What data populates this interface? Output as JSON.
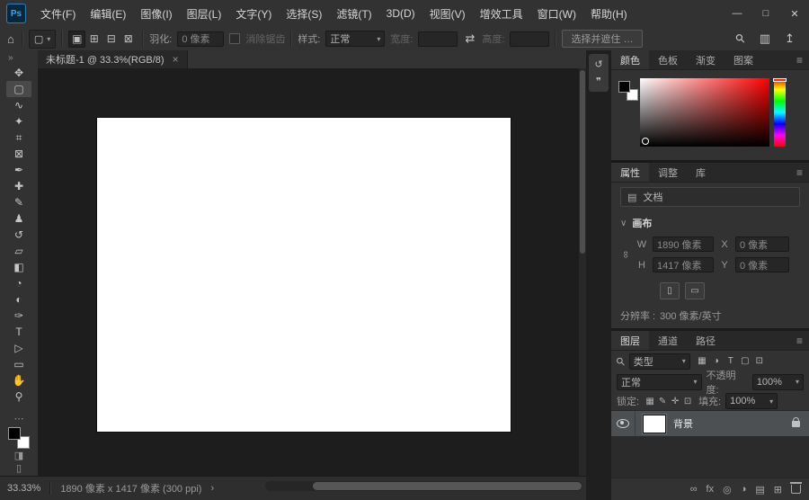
{
  "titlebar": {
    "logo": "Ps",
    "menus": [
      "文件(F)",
      "编辑(E)",
      "图像(I)",
      "图层(L)",
      "文字(Y)",
      "选择(S)",
      "滤镜(T)",
      "3D(D)",
      "视图(V)",
      "增效工具",
      "窗口(W)",
      "帮助(H)"
    ],
    "minimize": "—",
    "maximize": "□",
    "close": "✕"
  },
  "options_bar": {
    "home_icon": "⌂",
    "tool_preset_icon": "▢",
    "caret": "▾",
    "modes": [
      {
        "name": "new-selection-mode-button",
        "glyph": "▣",
        "active": true
      },
      {
        "name": "add-to-selection-mode-button",
        "glyph": "⊞"
      },
      {
        "name": "subtract-from-selection-mode-button",
        "glyph": "⊟"
      },
      {
        "name": "intersect-selection-mode-button",
        "glyph": "⊠"
      }
    ],
    "feather_label": "羽化:",
    "feather_value": "0 像素",
    "antialias_label": "消除锯齿",
    "style_label": "样式:",
    "style_value": "正常",
    "width_label": "宽度:",
    "width_value": "",
    "swap_icon": "⇄",
    "height_label": "高度:",
    "height_value": "",
    "select_and_mask_label": "选择并遮住 …",
    "search_icon": "⚲",
    "workspace_icon": "▥",
    "share_icon": "↥"
  },
  "document_tab": {
    "title": "未标题-1 @ 33.3%(RGB/8)",
    "close_icon": "×"
  },
  "toolbar": {
    "collapse_icon": "»",
    "tools": [
      {
        "name": "move-tool",
        "glyph": "✥"
      },
      {
        "name": "rectangular-marquee-tool",
        "glyph": "▢",
        "active": true
      },
      {
        "name": "lasso-tool",
        "glyph": "∿"
      },
      {
        "name": "quick-selection-tool",
        "glyph": "✦"
      },
      {
        "name": "crop-tool",
        "glyph": "⌗"
      },
      {
        "name": "frame-tool",
        "glyph": "⊠"
      },
      {
        "name": "eyedropper-tool",
        "glyph": "✒"
      },
      {
        "name": "spot-healing-brush-tool",
        "glyph": "✚"
      },
      {
        "name": "brush-tool",
        "glyph": "✎"
      },
      {
        "name": "clone-stamp-tool",
        "glyph": "♟"
      },
      {
        "name": "history-brush-tool",
        "glyph": "↺"
      },
      {
        "name": "eraser-tool",
        "glyph": "▱"
      },
      {
        "name": "gradient-tool",
        "glyph": "◧"
      },
      {
        "name": "blur-tool",
        "glyph": "◔"
      },
      {
        "name": "dodge-tool",
        "glyph": "◐"
      },
      {
        "name": "pen-tool",
        "glyph": "✑"
      },
      {
        "name": "type-tool",
        "glyph": "T"
      },
      {
        "name": "path-selection-tool",
        "glyph": "▷"
      },
      {
        "name": "rectangle-tool",
        "glyph": "▭"
      },
      {
        "name": "hand-tool",
        "glyph": "✋"
      },
      {
        "name": "zoom-tool",
        "glyph": "⚲"
      }
    ],
    "more_icon": "⋯",
    "quick_mask_icon": "◨",
    "screen_mode_icon": "▯"
  },
  "dock": {
    "buttons": [
      {
        "name": "history-panel-button",
        "glyph": "↺"
      },
      {
        "name": "comments-panel-button",
        "glyph": "❞"
      }
    ]
  },
  "color_panel": {
    "tabs": [
      {
        "name": "tab-color",
        "label": "颜色",
        "active": true
      },
      {
        "name": "tab-swatches",
        "label": "色板"
      },
      {
        "name": "tab-gradients",
        "label": "渐变"
      },
      {
        "name": "tab-patterns",
        "label": "图案"
      }
    ],
    "menu_icon": "≡"
  },
  "properties_panel": {
    "tabs": [
      {
        "name": "tab-properties",
        "label": "属性",
        "active": true
      },
      {
        "name": "tab-adjustments",
        "label": "调整"
      },
      {
        "name": "tab-libraries",
        "label": "库"
      }
    ],
    "menu_icon": "≡",
    "document_icon": "▤",
    "document_label": "文档",
    "canvas_caret": "∨",
    "canvas_label": "画布",
    "link_icon": "∞",
    "w_label": "W",
    "w_value": "1890 像素",
    "x_label": "X",
    "x_value": "0 像素",
    "h_label": "H",
    "h_value": "1417 像素",
    "y_label": "Y",
    "y_value": "0 像素",
    "portrait_icon": "▯",
    "landscape_icon": "▭",
    "resolution_label": "分辨率 :",
    "resolution_value": "300 像素/英寸"
  },
  "layers_panel": {
    "tabs": [
      {
        "name": "tab-layers",
        "label": "图层",
        "active": true
      },
      {
        "name": "tab-channels",
        "label": "通道"
      },
      {
        "name": "tab-paths",
        "label": "路径"
      }
    ],
    "menu_icon": "≡",
    "search_icon": "⚲",
    "filter_label": "类型",
    "caret": "▾",
    "filter_icons": [
      {
        "name": "filter-pixel-layers-icon",
        "glyph": "▦"
      },
      {
        "name": "filter-adjustment-layers-icon",
        "glyph": "◑"
      },
      {
        "name": "filter-type-layers-icon",
        "glyph": "T"
      },
      {
        "name": "filter-shape-layers-icon",
        "glyph": "▢"
      },
      {
        "name": "filter-smart-objects-icon",
        "glyph": "⊡"
      }
    ],
    "blend_mode": "正常",
    "opacity_label": "不透明度:",
    "opacity_value": "100%",
    "lock_label": "锁定:",
    "lock_icons": [
      {
        "name": "lock-transparent-pixels-icon",
        "glyph": "▦"
      },
      {
        "name": "lock-image-pixels-icon",
        "glyph": "✎"
      },
      {
        "name": "lock-position-icon",
        "glyph": "✛"
      },
      {
        "name": "lock-artboard-icon",
        "glyph": "⊡"
      }
    ],
    "fill_label": "填充:",
    "fill_value": "100%",
    "layer_name": "背景",
    "bottom_icons": [
      {
        "name": "link-layers-icon",
        "glyph": "∞"
      },
      {
        "name": "layer-effects-icon",
        "glyph": "fx"
      },
      {
        "name": "layer-mask-icon",
        "glyph": "◎"
      },
      {
        "name": "adjustment-layer-icon",
        "glyph": "◑"
      },
      {
        "name": "new-group-icon",
        "glyph": "▤"
      },
      {
        "name": "new-layer-icon",
        "glyph": "⊞"
      }
    ]
  },
  "status_bar": {
    "zoom": "33.33%",
    "doc_info": "1890 像素 x 1417 像素 (300 ppi)",
    "chevron": "›"
  }
}
